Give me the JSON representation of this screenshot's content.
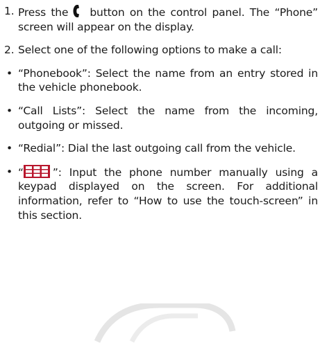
{
  "steps": [
    {
      "num": "1.",
      "pre": "Press the",
      "icon": "phone-handset-icon",
      "post": "button on the control panel. The “Phone” screen will appear on the display."
    },
    {
      "num": "2.",
      "text": "Select one of the following options to make a call:"
    }
  ],
  "bullets": [
    {
      "marker": "•",
      "text": "“Phonebook”: Select the name from an entry stored in the vehicle phonebook."
    },
    {
      "marker": "•",
      "text": "“Call Lists”: Select the name from the incoming, outgoing or missed."
    },
    {
      "marker": "•",
      "text": "“Redial”: Dial the last outgoing call from the vehicle."
    }
  ],
  "keypad_bullet": {
    "marker": "•",
    "open_quote": "“",
    "icon": "keypad-icon",
    "text": "”: Input the phone number manually using a keypad displayed on the screen. For additional information, refer to “How to use the touch-screen” in this section."
  },
  "colors": {
    "text": "#1a1a1a",
    "icon": "#111111",
    "keypad_red": "#b8162c"
  }
}
